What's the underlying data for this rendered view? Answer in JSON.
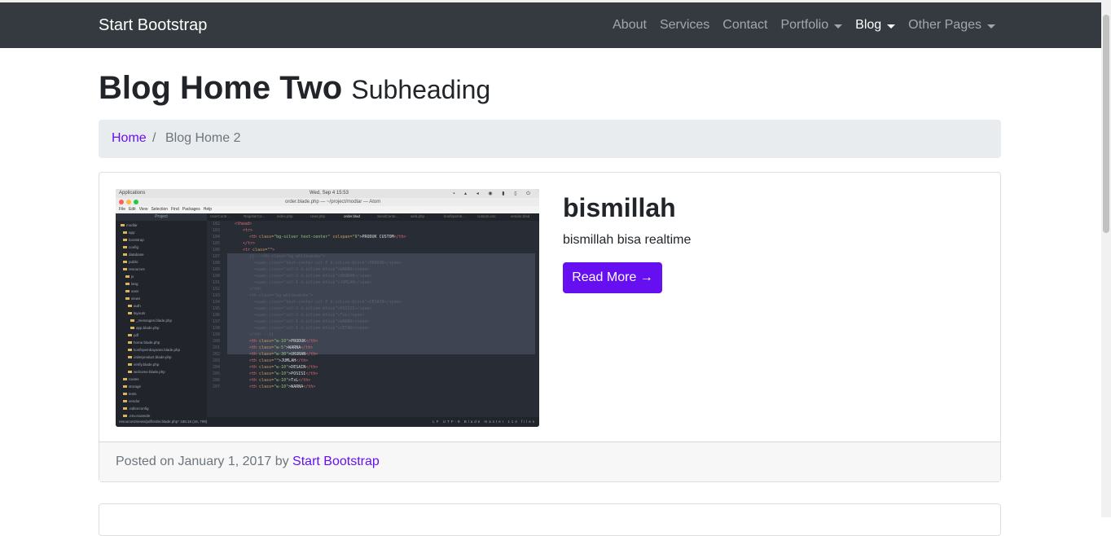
{
  "navbar": {
    "brand": "Start Bootstrap",
    "links": [
      {
        "label": "About"
      },
      {
        "label": "Services"
      },
      {
        "label": "Contact"
      },
      {
        "label": "Portfolio"
      },
      {
        "label": "Blog"
      },
      {
        "label": "Other Pages"
      }
    ]
  },
  "page": {
    "title": "Blog Home Two",
    "subtitle": "Subheading"
  },
  "breadcrumb": {
    "home": "Home",
    "separator": "/",
    "current": "Blog Home 2"
  },
  "post": {
    "title": "bismillah",
    "excerpt": "bismillah bisa realtime",
    "read_more": "Read More →",
    "footer_prefix": "Posted on January 1, 2017 by",
    "author": "Start Bootstrap",
    "thumbnail": {
      "topbar_apps": "Applications",
      "topbar_clock": "Wed, Sep 4   15:53",
      "window_title": "order.blade.php — ~/project/modlar — Atom",
      "menu": [
        "File",
        "Edit",
        "View",
        "Selection",
        "Find",
        "Packages",
        "Help"
      ],
      "tree_header": "Project",
      "tree": [
        "modlar",
        "app",
        "bootstrap",
        "config",
        "database",
        "public",
        "resources",
        "js",
        "lang",
        "sass",
        "views",
        "auth",
        "layouts",
        "_messages.blade.php",
        "app.blade.php",
        "pdf",
        "home.blade.php",
        "konfirpembayaran.blade.php",
        "orderproduct.blade.php",
        "verify.blade.php",
        "welcome.blade.php",
        "routes",
        "storage",
        "tests",
        "vendor",
        ".editorconfig",
        ".env.example"
      ],
      "tabs": [
        "UserContr...",
        "RegisterCo...",
        "index.php",
        "User.php",
        "order.blad",
        "SendConte...",
        "web.php",
        "konfirpemb...",
        "custom.css",
        "vendor.blad"
      ],
      "status_left": "resources/views/pdf/order.blade.php*   186:16   (16, 799)",
      "status_right": "LF  UTF-8  Blade  master  114 files"
    }
  },
  "colors": {
    "navbar_bg": "#343a40",
    "accent": "#6610f2",
    "breadcrumb_bg": "#e9ecef"
  }
}
